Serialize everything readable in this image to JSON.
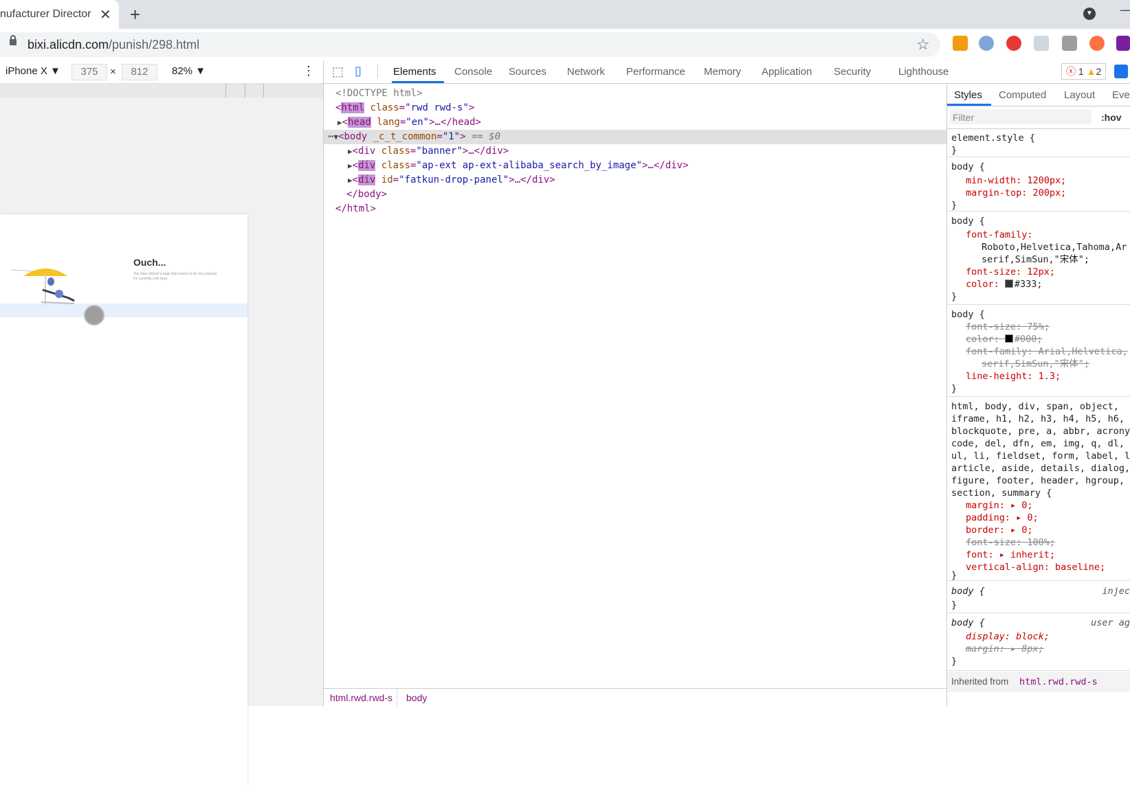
{
  "browser": {
    "tab_title": "nufacturer Director",
    "tab_close": "✕",
    "new_tab": "+",
    "url_host": "bixi.alicdn.com",
    "url_path": "/punish/298.html",
    "minimize": "—"
  },
  "device_toolbar": {
    "device": "iPhone X ▼",
    "width": "375",
    "times": "×",
    "height": "812",
    "zoom": "82% ▼",
    "more": "⋮"
  },
  "mobile_page": {
    "title": "Ouch...",
    "subtitle": "You have clicked a page that seems to be very popular. It's currently a bit busy."
  },
  "devtools": {
    "tabs": [
      "Elements",
      "Console",
      "Sources",
      "Network",
      "Performance",
      "Memory",
      "Application",
      "Security",
      "Lighthouse"
    ],
    "issues_errors": "1",
    "issues_warnings": "2"
  },
  "dom_tree": {
    "doctype": "<!DOCTYPE html>",
    "html_tag": "html",
    "html_class": "\"rwd rwd-s\"",
    "head_tag": "head",
    "head_lang": "\"en\"",
    "body_tag": "body",
    "body_attr": "_c_t_common",
    "body_attr_val": "\"1\"",
    "body_suffix": "== $0",
    "div1_class": "\"banner\"",
    "div2_tag": "div",
    "div2_class": "\"ap-ext ap-ext-alibaba_search_by_image\"",
    "div3_tag": "div",
    "div3_id": "\"fatkun-drop-panel\"",
    "close_body": "</body>",
    "close_html": "</html>"
  },
  "breadcrumb": [
    "html.rwd.rwd-s",
    "body"
  ],
  "styles_pane": {
    "tabs": [
      "Styles",
      "Computed",
      "Layout",
      "Ever"
    ],
    "filter_placeholder": "Filter",
    "hov": ":hov",
    "element_style": "element.style {",
    "rule2_selector": "body {",
    "rule2_props": [
      "min-width: 1200px;",
      "margin-top: 200px;"
    ],
    "rule3_selector": "body {",
    "rule3_font_family": "font-family:",
    "rule3_font_values": [
      "Roboto,Helvetica,Tahoma,Ar",
      "serif,SimSun,\"宋体\";"
    ],
    "rule3_font_size": "font-size: 12px;",
    "rule3_color": "color: ",
    "rule3_color_value": "#333;",
    "rule4_selector": "body {",
    "rule4_lines": [
      "font-size: 75%;",
      "color: ",
      "font-family: Arial,Helvetica,",
      "serif,SimSun,\"宋体\";",
      "line-height: 1.3;"
    ],
    "rule4_color_value": "#000;",
    "rule5_selector_lines": [
      "html, body, div, span, object,",
      "iframe, h1, h2, h3, h4, h5, h6,",
      "blockquote, pre, a, abbr, acrony",
      "code, del, dfn, em, img, q, dl,",
      "ul, li, fieldset, form, label, l",
      "article, aside, details, dialog,",
      "figure, footer, header, hgroup,",
      "section, summary {"
    ],
    "rule5_props": [
      "margin: ▸ 0;",
      "padding: ▸ 0;",
      "border: ▸ 0;",
      "font-size: 100%;",
      "font: ▸ inherit;",
      "vertical-align: baseline;"
    ],
    "rule6_selector": "body {",
    "rule6_source": "injec",
    "rule7_selector": "body {",
    "rule7_source": "user ag",
    "rule7_props": [
      "display: block;",
      "margin: ▸ 8px;"
    ],
    "inherited": "Inherited from ",
    "inherited_el": "html.rwd.rwd-s",
    "close": "}"
  },
  "colors": {
    "accent": "#1a73e8",
    "tag": "#881280",
    "attr": "#994500",
    "value": "#1a1aa6",
    "sun_umbrella": "#f6c324"
  }
}
